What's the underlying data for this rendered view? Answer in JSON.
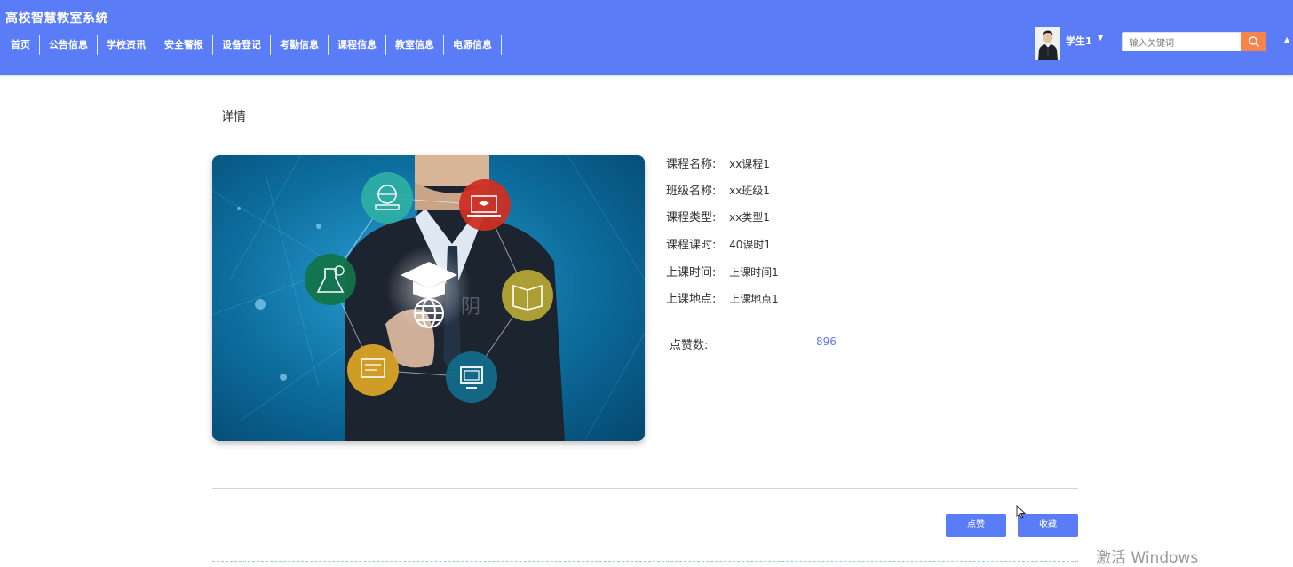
{
  "header": {
    "app_title": "高校智慧教室系统",
    "nav": [
      {
        "label": "首页"
      },
      {
        "label": "公告信息"
      },
      {
        "label": "学校资讯"
      },
      {
        "label": "安全警报"
      },
      {
        "label": "设备登记"
      },
      {
        "label": "考勤信息"
      },
      {
        "label": "课程信息"
      },
      {
        "label": "教室信息"
      },
      {
        "label": "电源信息"
      }
    ],
    "user_name": "学生1",
    "search_placeholder": "输入关键词",
    "colors": {
      "header_bg": "#5a7df7",
      "search_button": "#f7844b"
    }
  },
  "detail": {
    "section_title": "详情",
    "fields": [
      {
        "label": "课程名称:",
        "value": "xx课程1"
      },
      {
        "label": "班级名称:",
        "value": "xx班级1"
      },
      {
        "label": "课程类型:",
        "value": "xx类型1"
      },
      {
        "label": "课程课时:",
        "value": "40课时1"
      },
      {
        "label": "上课时间:",
        "value": "上课时间1"
      },
      {
        "label": "上课地点:",
        "value": "上课地点1"
      }
    ],
    "likes_label": "点赞数:",
    "likes_value": "896"
  },
  "actions": {
    "like_label": "点赞",
    "favorite_label": "收藏"
  },
  "os_watermark": "激活 Windows",
  "icons": [
    "search-icon",
    "caret-down-icon",
    "graduation-cap-icon",
    "globe-icon",
    "laptop-icon",
    "book-icon",
    "flask-icon",
    "monitor-icon",
    "reading-icon",
    "mouse-cursor-icon"
  ]
}
